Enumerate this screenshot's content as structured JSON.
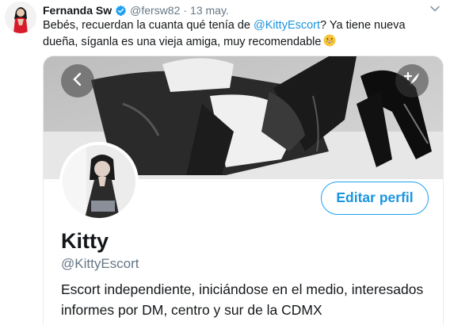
{
  "tweet": {
    "author_name": "Fernanda Sw",
    "author_handle": "@fersw82",
    "separator": "·",
    "date": "13 may.",
    "text_before": "Bebés, recuerdan la cuanta qué tenía de ",
    "mention": "@KittyEscort",
    "text_after": "? Ya tiene nueva dueña, síganla es una vieja amiga, muy recomendable",
    "emoji": "smiling-face-emoji",
    "icons": {
      "verified": "verified-badge-icon",
      "caret": "chevron-down-icon"
    }
  },
  "profile_card": {
    "edit_button_label": "Editar perfil",
    "name": "Kitty",
    "handle": "@KittyEscort",
    "bio": "Escort independiente, iniciándose en el medio, interesados informes por DM, centro y sur de la CDMX",
    "icons": {
      "back": "chevron-left-icon",
      "share": "share-quill-icon"
    }
  },
  "colors": {
    "accent": "#1da1f2",
    "link": "#1b95e0",
    "secondary_text": "#657786",
    "verified": "#1da1f2"
  }
}
